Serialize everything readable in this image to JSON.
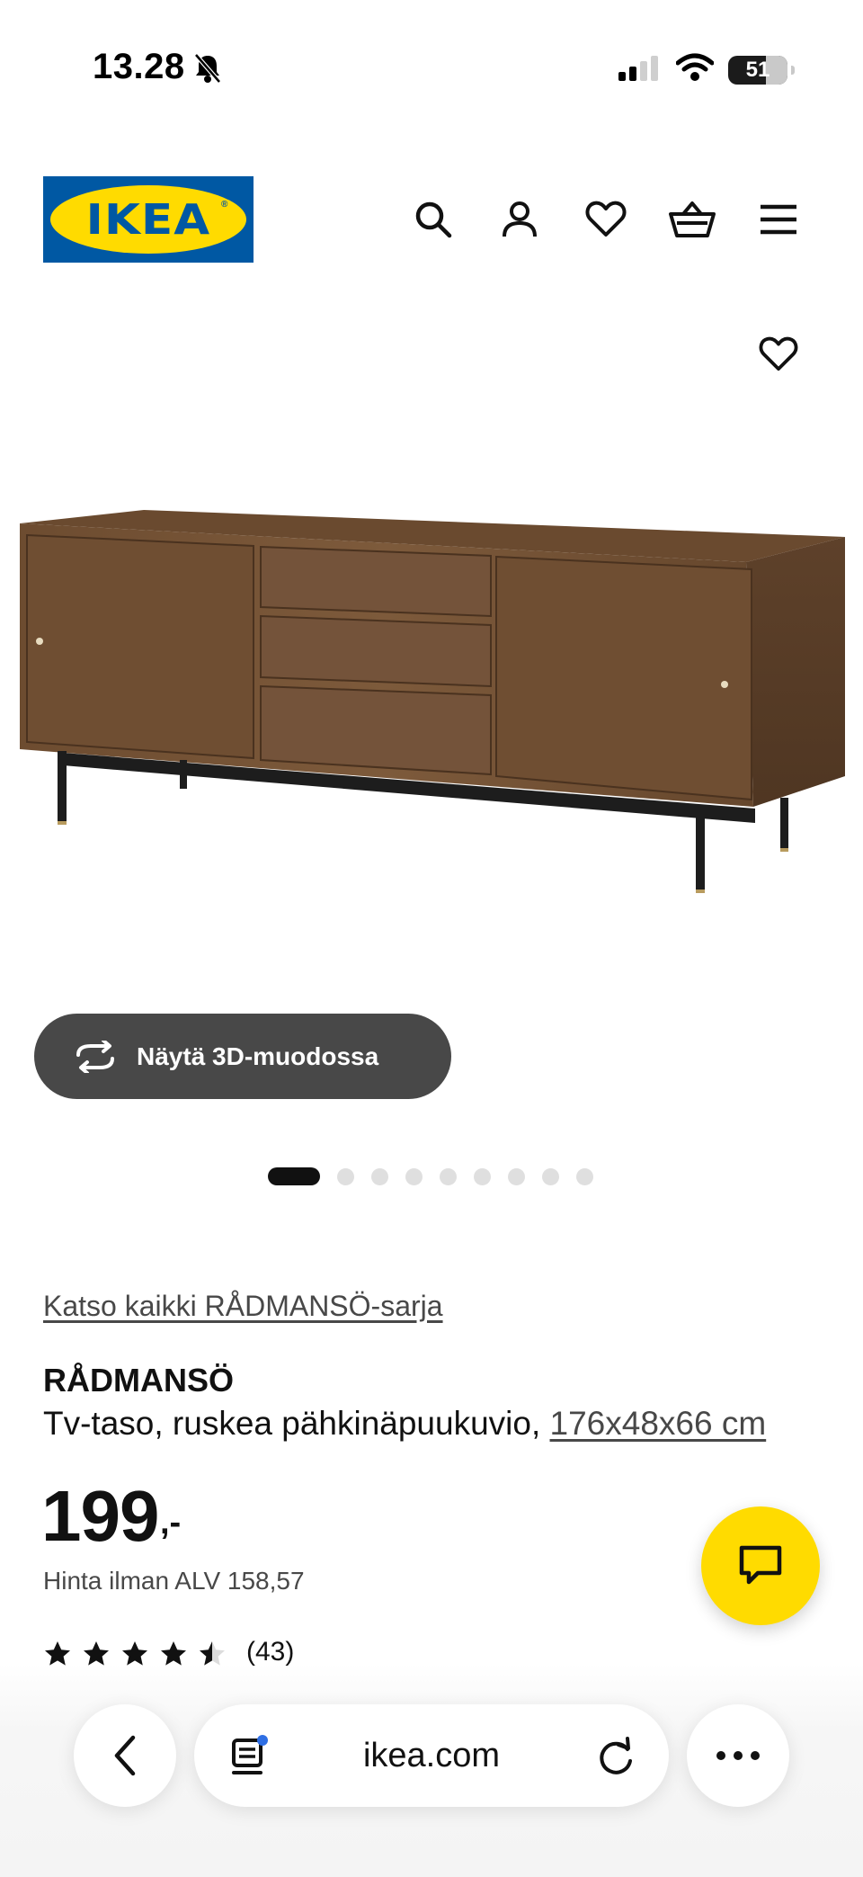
{
  "status_bar": {
    "time": "13.28",
    "battery": "51"
  },
  "header": {
    "logo_text": "IKEA",
    "icons": [
      "search-icon",
      "account-icon",
      "heart-icon",
      "basket-icon",
      "menu-icon"
    ]
  },
  "gallery": {
    "view_3d_label": "Näytä 3D-muodossa",
    "image_count": 9,
    "active_image": 1
  },
  "product": {
    "series_link": "Katso kaikki RÅDMANSÖ-sarja",
    "name": "RÅDMANSÖ",
    "description": "Tv-taso, ruskea pähkinäpuukuvio, ",
    "dimensions": "176x48x66 cm",
    "price": "199",
    "price_suffix": ",-",
    "price_without_vat": "Hinta ilman ALV 158,57",
    "rating": 4.5,
    "review_count": "(43)"
  },
  "browser": {
    "url": "ikea.com"
  },
  "colors": {
    "ikea_blue": "#0058a3",
    "ikea_yellow": "#ffdb00",
    "dark_button": "#484848"
  }
}
